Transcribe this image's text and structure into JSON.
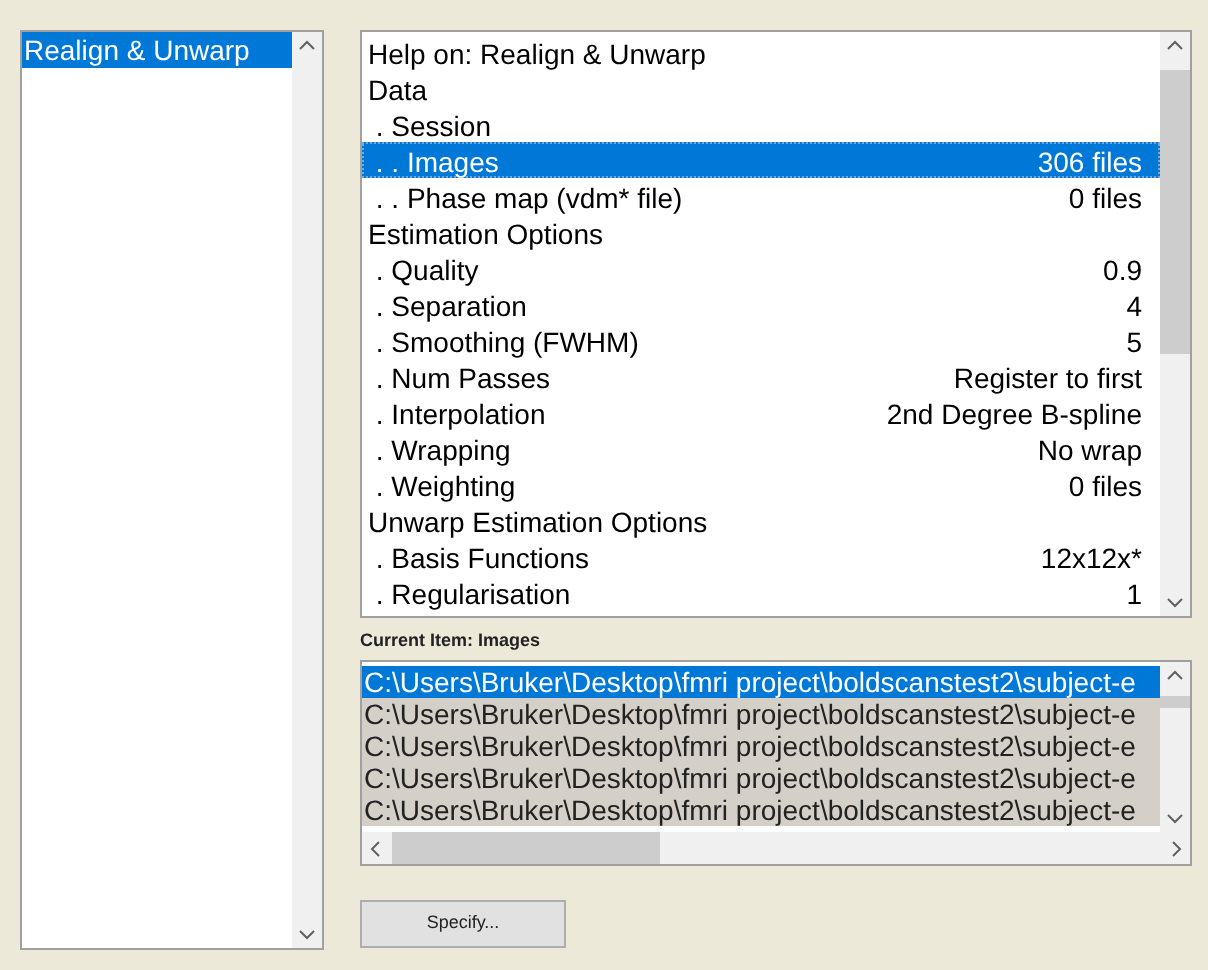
{
  "modules": [
    {
      "label": "Realign & Unwarp",
      "selected": true
    }
  ],
  "help_list": [
    {
      "label": "Help on: Realign & Unwarp",
      "selected": false
    },
    {
      "label": "Data",
      "selected": false
    },
    {
      "label": " . Session",
      "selected": false
    },
    {
      "label": " . . Images",
      "value": "306 files",
      "selected": true
    },
    {
      "label": " . . Phase map (vdm* file)",
      "value": "0 files",
      "selected": false
    },
    {
      "label": "Estimation Options",
      "selected": false
    },
    {
      "label": " . Quality",
      "value": "0.9",
      "selected": false
    },
    {
      "label": " . Separation",
      "value": "4",
      "selected": false
    },
    {
      "label": " . Smoothing (FWHM)",
      "value": "5",
      "selected": false
    },
    {
      "label": " . Num Passes",
      "value": "Register to first",
      "selected": false
    },
    {
      "label": " . Interpolation",
      "value": "2nd Degree B-spline",
      "selected": false
    },
    {
      "label": " . Wrapping",
      "value": "No wrap",
      "selected": false
    },
    {
      "label": " . Weighting",
      "value": "0 files",
      "selected": false
    },
    {
      "label": "Unwarp Estimation Options",
      "selected": false
    },
    {
      "label": " . Basis Functions",
      "value": "12x12x*",
      "selected": false
    },
    {
      "label": " . Regularisation",
      "value": "1",
      "selected": false
    }
  ],
  "current_item": "Current Item: Images",
  "files": [
    {
      "path": "C:\\Users\\Bruker\\Desktop\\fmri project\\boldscanstest2\\subject-e",
      "focused": true
    },
    {
      "path": "C:\\Users\\Bruker\\Desktop\\fmri project\\boldscanstest2\\subject-e",
      "focused": false
    },
    {
      "path": "C:\\Users\\Bruker\\Desktop\\fmri project\\boldscanstest2\\subject-e",
      "focused": false
    },
    {
      "path": "C:\\Users\\Bruker\\Desktop\\fmri project\\boldscanstest2\\subject-e",
      "focused": false
    },
    {
      "path": "C:\\Users\\Bruker\\Desktop\\fmri project\\boldscanstest2\\subject-e",
      "focused": false
    }
  ],
  "specify_button": "Specify..."
}
